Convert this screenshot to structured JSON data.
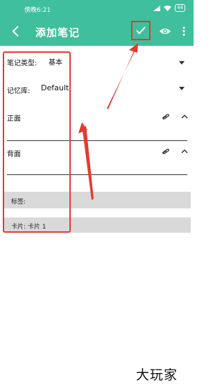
{
  "status": {
    "time": "傍晚6:21",
    "battery": "44"
  },
  "header": {
    "title": "添加笔记"
  },
  "form": {
    "note_type_label": "笔记类型:",
    "note_type_value": "基本",
    "deck_label": "记忆库:",
    "deck_value": "Default",
    "front_label": "正面",
    "back_label": "背面",
    "tags_label": "标签:",
    "cards_label": "卡片: 卡片 1"
  },
  "watermark": "大玩家",
  "colors": {
    "accent": "#3fbf9b",
    "annotation_red": "#e43a2e"
  }
}
